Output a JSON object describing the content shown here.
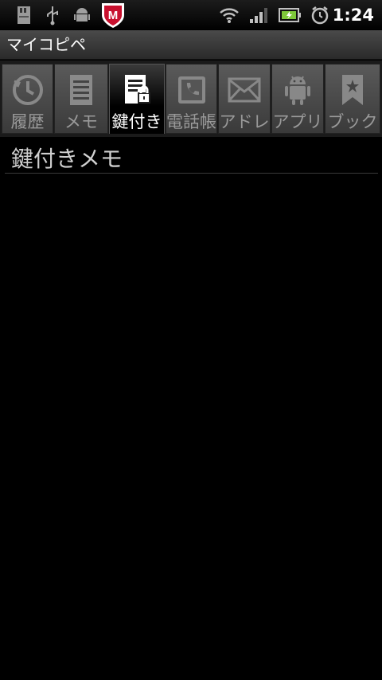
{
  "status_bar": {
    "time": "1:24",
    "icons": [
      "sd-card-icon",
      "usb-icon",
      "android-debug-icon",
      "mcafee-shield-icon",
      "wifi-icon",
      "signal-icon",
      "battery-icon",
      "alarm-icon"
    ],
    "shield_letter": "M"
  },
  "app": {
    "title": "マイコピペ"
  },
  "tabs": [
    {
      "label": "履歴",
      "icon": "history-icon",
      "selected": false
    },
    {
      "label": "メモ",
      "icon": "memo-icon",
      "selected": false
    },
    {
      "label": "鍵付き",
      "icon": "locked-memo-icon",
      "selected": true
    },
    {
      "label": "電話帳",
      "icon": "phone-book-icon",
      "selected": false
    },
    {
      "label": "アドレ",
      "icon": "mail-icon",
      "selected": false
    },
    {
      "label": "アプリ",
      "icon": "android-icon",
      "selected": false
    },
    {
      "label": "ブック",
      "icon": "bookmark-icon",
      "selected": false
    }
  ],
  "main": {
    "heading": "鍵付きメモ"
  },
  "colors": {
    "accent_green": "#7ec83a",
    "shield_red": "#c8102e",
    "selected_tab_text": "#ffffff",
    "unselected_tab_text": "#9a9a9a"
  }
}
